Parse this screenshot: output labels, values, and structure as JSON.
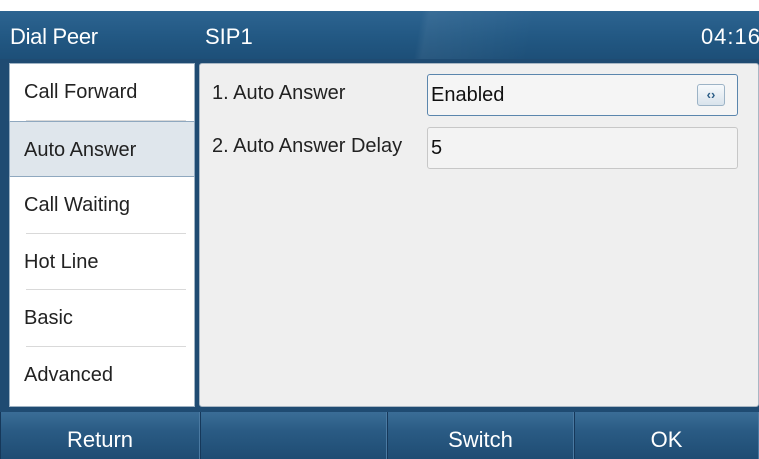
{
  "header": {
    "app_title": "Dial Peer",
    "account": "SIP1",
    "time": "04:16"
  },
  "sidebar": {
    "items": [
      {
        "label": "Call Forward",
        "active": false
      },
      {
        "label": "Auto Answer",
        "active": true
      },
      {
        "label": "Call Waiting",
        "active": false
      },
      {
        "label": "Hot Line",
        "active": false
      },
      {
        "label": "Basic",
        "active": false
      },
      {
        "label": "Advanced",
        "active": false
      }
    ]
  },
  "settings": {
    "rows": [
      {
        "label": "1. Auto Answer",
        "value": "Enabled",
        "type": "select",
        "select_glyph": "‹›"
      },
      {
        "label": "2. Auto Answer Delay",
        "value": "5",
        "type": "text"
      }
    ]
  },
  "softkeys": [
    "Return",
    "",
    "Switch",
    "OK"
  ],
  "colors": {
    "header_bg": "#225883",
    "softkey_bg": "#2a5b84",
    "active_item_bg": "#dfe6ec",
    "content_bg": "#efefef"
  }
}
